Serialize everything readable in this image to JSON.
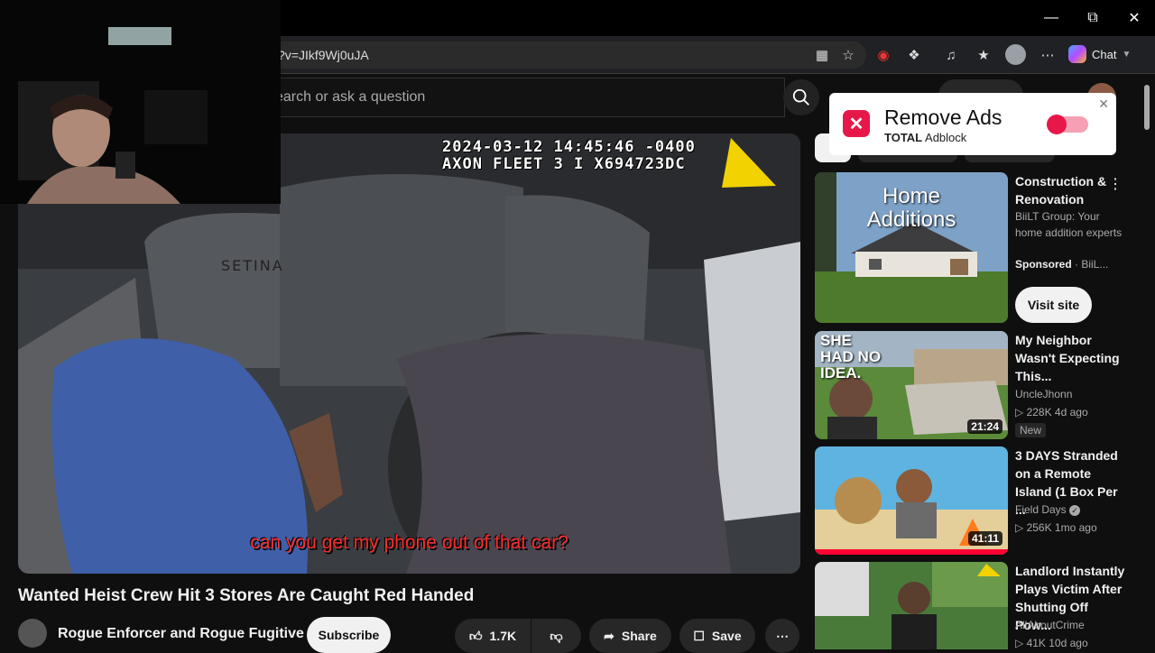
{
  "browser": {
    "url": "?v=JIkf9Wj0uJA",
    "chat_label": "Chat",
    "window_controls": [
      "minimize-icon",
      "restore-icon",
      "close-icon"
    ]
  },
  "search": {
    "placeholder": "earch or ask a question"
  },
  "video": {
    "timestamp_line1": "2024-03-12 14:45:46 -0400",
    "timestamp_line2": "AXON FLEET 3 I X694723DC",
    "subtitle": "can you get my phone out of that car?",
    "seat_text": "SETINA",
    "title": "Wanted Heist Crew Hit 3 Stores Are Caught Red Handed",
    "channel": "Rogue Enforcer and Rogue Fugitive",
    "subscribe_label": "Subscribe",
    "like_count": "1.7K",
    "share_label": "Share",
    "save_label": "Save"
  },
  "ad_popup": {
    "title": "Remove Ads",
    "brand_bold": "TOTAL",
    "brand_rest": "Adblock"
  },
  "sidebar": {
    "sponsored": {
      "thumb_text_1": "Home",
      "thumb_text_2": "Additions",
      "title": "Construction & Renovation",
      "desc": "BiiLT Group: Your home addition experts",
      "sponsored_label": "Sponsored",
      "advertiser": "· BiiL...",
      "cta": "Visit site"
    },
    "videos": [
      {
        "title": "My Neighbor Wasn't Expecting This...",
        "channel": "UncleJhonn",
        "meta": "▷ 228K  4d ago",
        "badge": "New",
        "duration": "21:24",
        "thumb_text": "SHE HAD NO IDEA."
      },
      {
        "title": "3 DAYS Stranded on a Remote Island (1 Box Per ...",
        "channel": "Field Days",
        "meta": "▷ 256K  1mo ago",
        "duration": "41:11"
      },
      {
        "title": "Landlord Instantly Plays Victim After Shutting Off Pow...",
        "channel": "AllAboutCrime",
        "meta": "▷ 41K  10d ago"
      }
    ]
  },
  "colors": {
    "accent": "#ff0033",
    "popup_toggle": "#e8174a"
  }
}
